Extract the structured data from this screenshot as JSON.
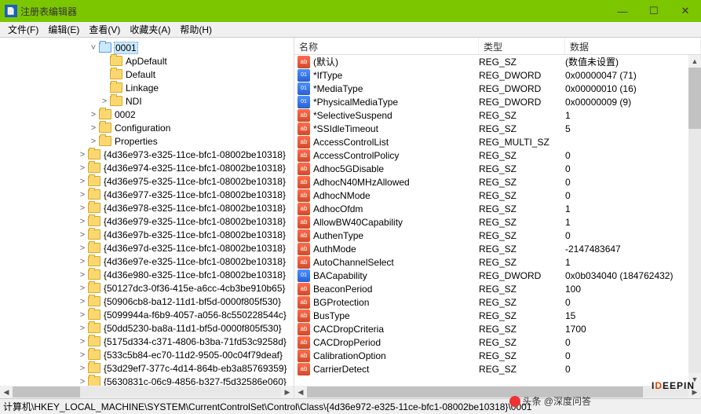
{
  "window": {
    "title": "注册表编辑器"
  },
  "menus": [
    "文件(F)",
    "编辑(E)",
    "查看(V)",
    "收藏夹(A)",
    "帮助(H)"
  ],
  "tree": {
    "selected": "0001",
    "children_of_0001": [
      "ApDefault",
      "Default",
      "Linkage",
      "NDI"
    ],
    "siblings_after": [
      "0002",
      "Configuration",
      "Properties"
    ],
    "guids": [
      "{4d36e973-e325-11ce-bfc1-08002be10318}",
      "{4d36e974-e325-11ce-bfc1-08002be10318}",
      "{4d36e975-e325-11ce-bfc1-08002be10318}",
      "{4d36e977-e325-11ce-bfc1-08002be10318}",
      "{4d36e978-e325-11ce-bfc1-08002be10318}",
      "{4d36e979-e325-11ce-bfc1-08002be10318}",
      "{4d36e97b-e325-11ce-bfc1-08002be10318}",
      "{4d36e97d-e325-11ce-bfc1-08002be10318}",
      "{4d36e97e-e325-11ce-bfc1-08002be10318}",
      "{4d36e980-e325-11ce-bfc1-08002be10318}",
      "{50127dc3-0f36-415e-a6cc-4cb3be910b65}",
      "{50906cb8-ba12-11d1-bf5d-0000f805f530}",
      "{5099944a-f6b9-4057-a056-8c550228544c}",
      "{50dd5230-ba8a-11d1-bf5d-0000f805f530}",
      "{5175d334-c371-4806-b3ba-71fd53c9258d}",
      "{533c5b84-ec70-11d2-9505-00c04f79deaf}",
      "{53d29ef7-377c-4d14-864b-eb3a85769359}",
      "{5630831c-06c9-4856-b327-f5d32586e060}"
    ]
  },
  "list": {
    "headers": {
      "name": "名称",
      "type": "类型",
      "data": "数据"
    },
    "rows": [
      {
        "icon": "str",
        "name": "(默认)",
        "type": "REG_SZ",
        "data": "(数值未设置)"
      },
      {
        "icon": "bin",
        "name": "*IfType",
        "type": "REG_DWORD",
        "data": "0x00000047 (71)"
      },
      {
        "icon": "bin",
        "name": "*MediaType",
        "type": "REG_DWORD",
        "data": "0x00000010 (16)"
      },
      {
        "icon": "bin",
        "name": "*PhysicalMediaType",
        "type": "REG_DWORD",
        "data": "0x00000009 (9)"
      },
      {
        "icon": "str",
        "name": "*SelectiveSuspend",
        "type": "REG_SZ",
        "data": "1"
      },
      {
        "icon": "str",
        "name": "*SSIdleTimeout",
        "type": "REG_SZ",
        "data": "5"
      },
      {
        "icon": "str",
        "name": "AccessControlList",
        "type": "REG_MULTI_SZ",
        "data": ""
      },
      {
        "icon": "str",
        "name": "AccessControlPolicy",
        "type": "REG_SZ",
        "data": "0"
      },
      {
        "icon": "str",
        "name": "Adhoc5GDisable",
        "type": "REG_SZ",
        "data": "0"
      },
      {
        "icon": "str",
        "name": "AdhocN40MHzAllowed",
        "type": "REG_SZ",
        "data": "0"
      },
      {
        "icon": "str",
        "name": "AdhocNMode",
        "type": "REG_SZ",
        "data": "0"
      },
      {
        "icon": "str",
        "name": "AdhocOfdm",
        "type": "REG_SZ",
        "data": "1"
      },
      {
        "icon": "str",
        "name": "AllowBW40Capability",
        "type": "REG_SZ",
        "data": "1"
      },
      {
        "icon": "str",
        "name": "AuthenType",
        "type": "REG_SZ",
        "data": "0"
      },
      {
        "icon": "str",
        "name": "AuthMode",
        "type": "REG_SZ",
        "data": "-2147483647"
      },
      {
        "icon": "str",
        "name": "AutoChannelSelect",
        "type": "REG_SZ",
        "data": "1"
      },
      {
        "icon": "bin",
        "name": "BACapability",
        "type": "REG_DWORD",
        "data": "0x0b034040 (184762432)"
      },
      {
        "icon": "str",
        "name": "BeaconPeriod",
        "type": "REG_SZ",
        "data": "100"
      },
      {
        "icon": "str",
        "name": "BGProtection",
        "type": "REG_SZ",
        "data": "0"
      },
      {
        "icon": "str",
        "name": "BusType",
        "type": "REG_SZ",
        "data": "15"
      },
      {
        "icon": "str",
        "name": "CACDropCriteria",
        "type": "REG_SZ",
        "data": "1700"
      },
      {
        "icon": "str",
        "name": "CACDropPeriod",
        "type": "REG_SZ",
        "data": "0"
      },
      {
        "icon": "str",
        "name": "CalibrationOption",
        "type": "REG_SZ",
        "data": "0"
      },
      {
        "icon": "str",
        "name": "CarrierDetect",
        "type": "REG_SZ",
        "data": "0"
      }
    ]
  },
  "status": "计算机\\HKEY_LOCAL_MACHINE\\SYSTEM\\CurrentControlSet\\Control\\Class\\{4d36e972-e325-11ce-bfc1-08002be10318}\\0001",
  "watermark": {
    "a": "I",
    "b": "D",
    "c": "EEPIN",
    "sub": "头条 @深度问答"
  }
}
